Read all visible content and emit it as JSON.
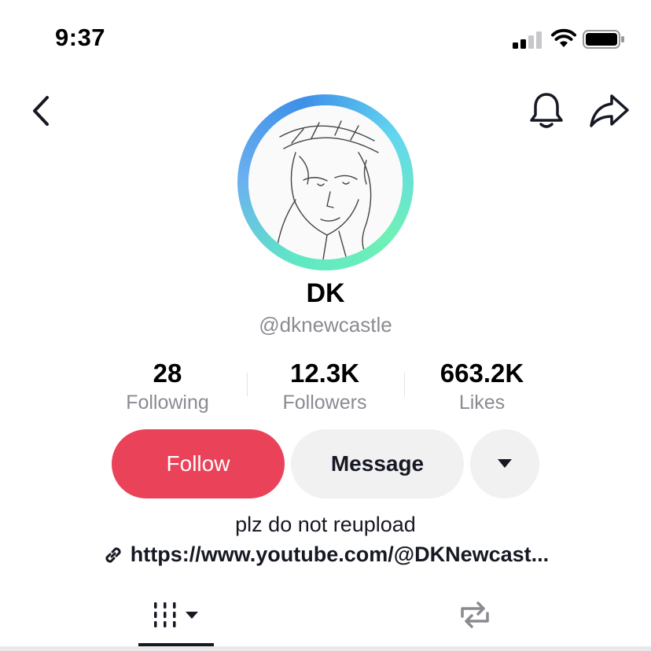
{
  "status_bar": {
    "time": "9:37"
  },
  "profile": {
    "display_name": "DK",
    "username": "@dknewcastle",
    "stats": [
      {
        "value": "28",
        "label": "Following"
      },
      {
        "value": "12.3K",
        "label": "Followers"
      },
      {
        "value": "663.2K",
        "label": "Likes"
      }
    ],
    "bio": "plz do not reupload",
    "link": "https://www.youtube.com/@DKNewcast..."
  },
  "actions": {
    "follow_label": "Follow",
    "message_label": "Message"
  },
  "colors": {
    "follow": "#ea4359",
    "ring_blue": "#3d8fe8",
    "ring_green": "#6ff0b6"
  },
  "icons": [
    "back-icon",
    "bell-icon",
    "share-icon",
    "dropdown-icon",
    "link-icon",
    "grid-icon",
    "repost-icon"
  ]
}
